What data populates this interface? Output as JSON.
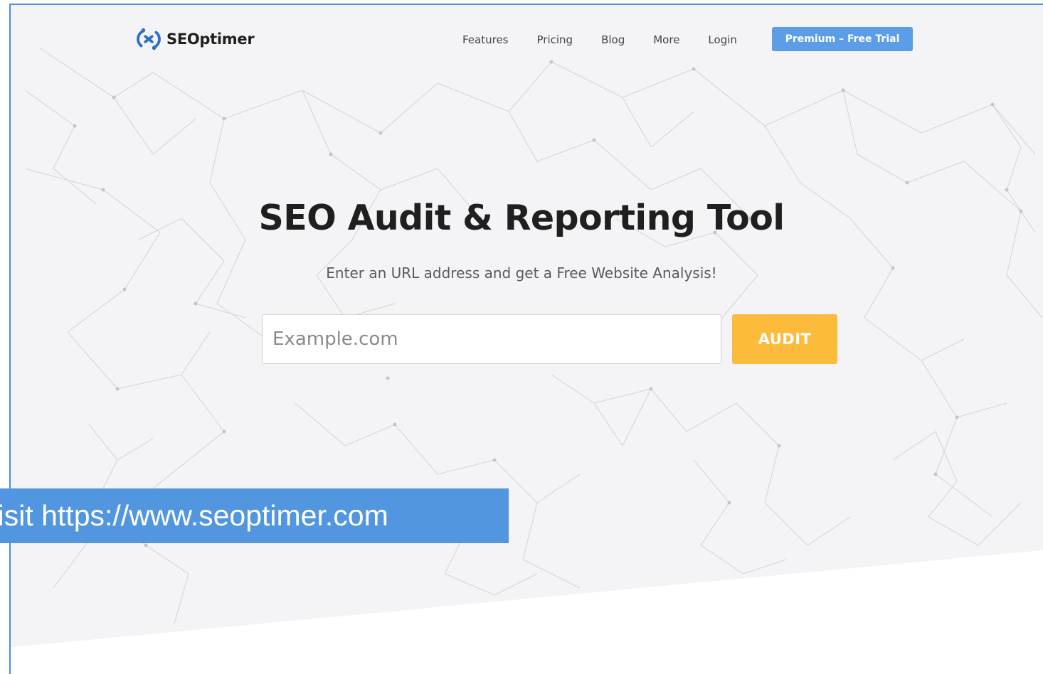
{
  "brand": {
    "name": "SEOptimer",
    "icon": "seoptimer-logo-icon",
    "color": "#2b6fc7"
  },
  "nav": {
    "items": [
      {
        "label": "Features"
      },
      {
        "label": "Pricing"
      },
      {
        "label": "Blog"
      },
      {
        "label": "More"
      },
      {
        "label": "Login"
      }
    ],
    "cta_label": "Premium – Free Trial",
    "cta_color": "#5b9de6"
  },
  "hero": {
    "title": "SEO Audit & Reporting Tool",
    "subtitle": "Enter an URL address and get a Free Website Analysis!",
    "input_placeholder": "Example.com",
    "button_label": "AUDIT",
    "button_color": "#fdbb3c",
    "background_color": "#f4f4f6"
  },
  "overlay": {
    "text": "Visit https://www.seoptimer.com",
    "color": "#5296e0"
  }
}
